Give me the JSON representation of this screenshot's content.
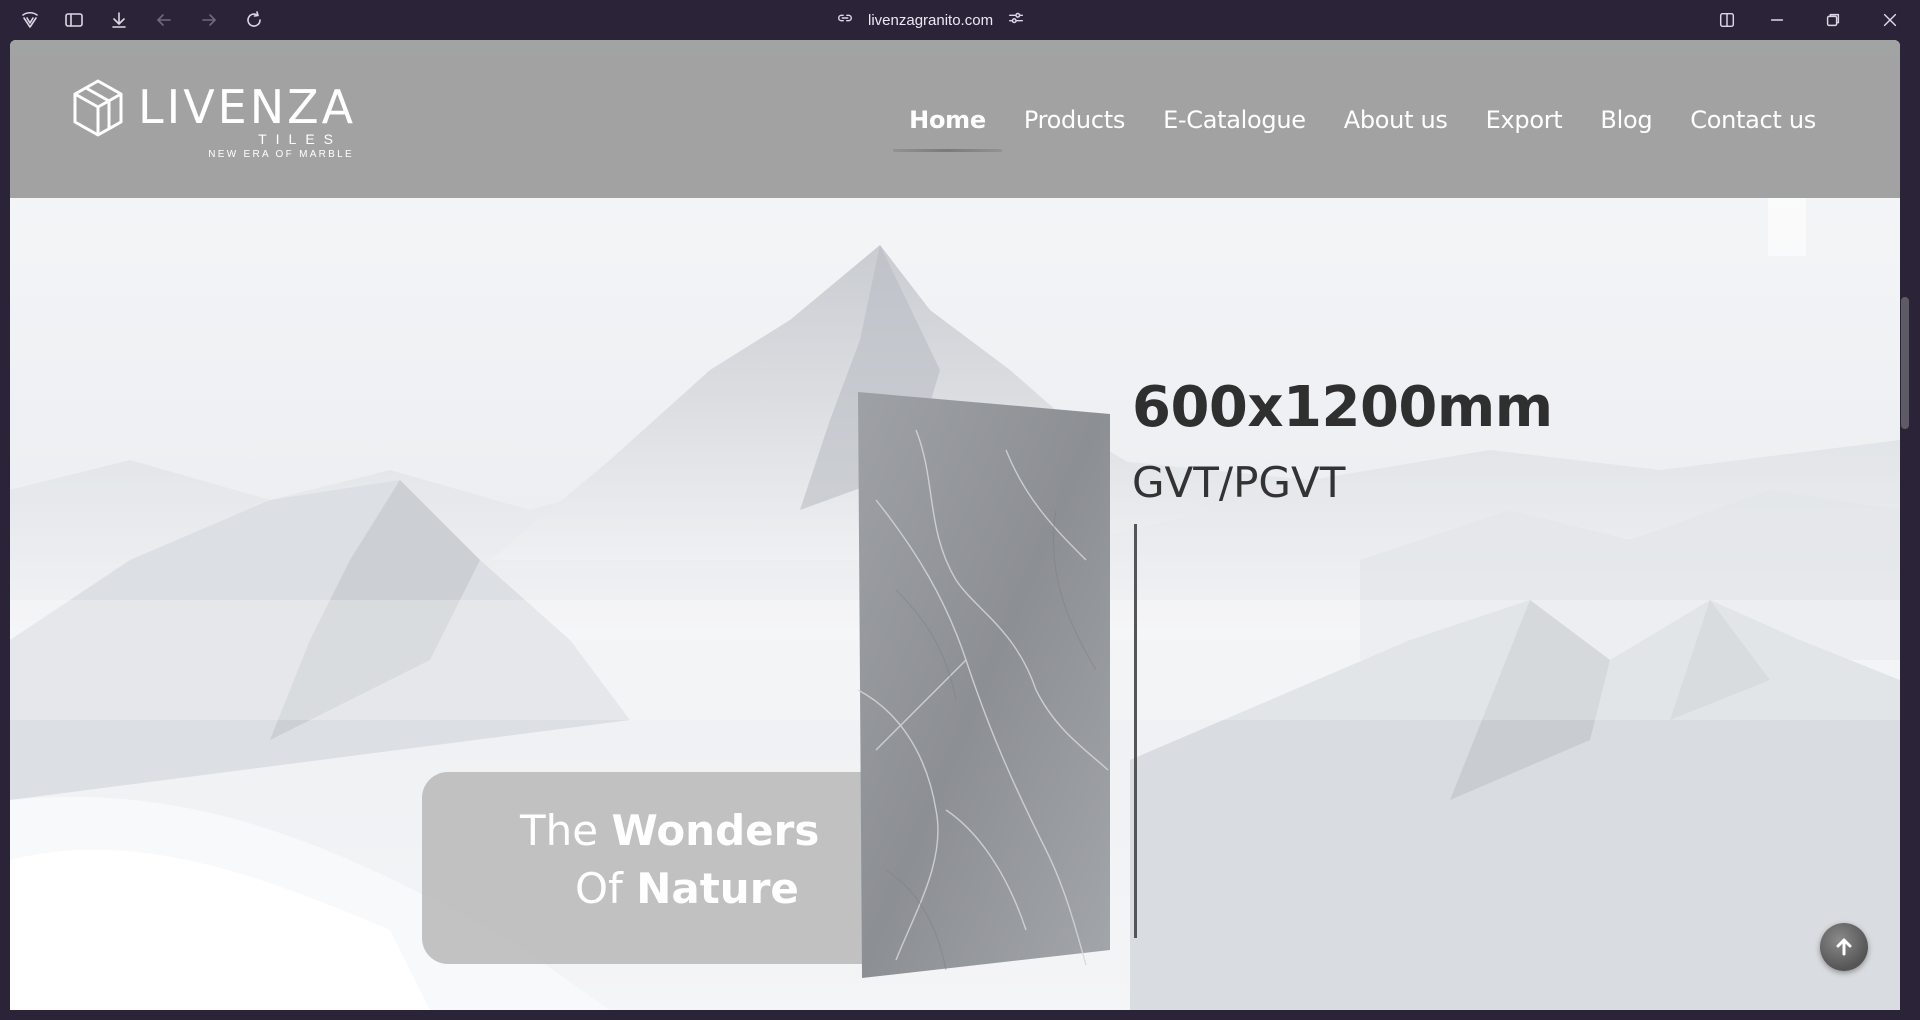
{
  "browser": {
    "url": "livenzagranito.com",
    "icons": [
      "app-menu-icon",
      "sidebar-icon",
      "download-icon",
      "back-icon",
      "forward-icon",
      "reload-icon",
      "link-icon",
      "site-settings-icon",
      "split-view-icon",
      "minimize-icon",
      "restore-icon",
      "close-icon"
    ]
  },
  "site": {
    "logo": {
      "word": "LIVENZA",
      "sub": "TILES",
      "tagline": "NEW ERA OF MARBLE"
    },
    "nav": [
      {
        "label": "Home",
        "active": true
      },
      {
        "label": "Products",
        "active": false
      },
      {
        "label": "E-Catalogue",
        "active": false
      },
      {
        "label": "About us",
        "active": false
      },
      {
        "label": "Export",
        "active": false
      },
      {
        "label": "Blog",
        "active": false
      },
      {
        "label": "Contact us",
        "active": false
      }
    ]
  },
  "hero": {
    "size": "600x1200mm",
    "type": "GVT/PGVT",
    "card": {
      "line1_light": "The",
      "line1_bold": "Wonders",
      "line2_light": "Of",
      "line2_bold": "Nature"
    }
  },
  "colors": {
    "chrome_bg": "#2b2438",
    "header_overlay": "#969696",
    "text_dark": "#2f2f2f"
  }
}
